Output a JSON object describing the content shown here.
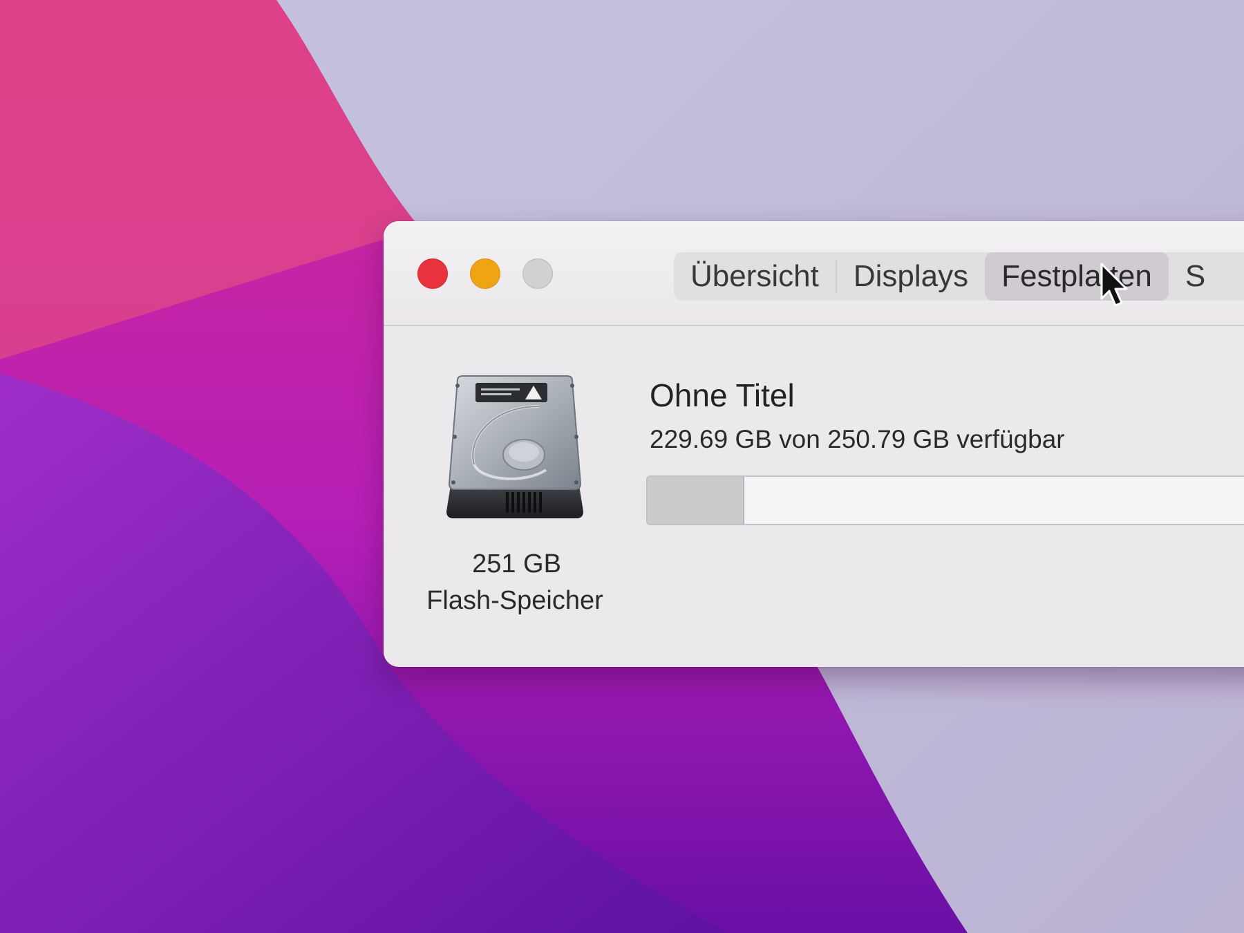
{
  "window": {
    "tabs": [
      {
        "label": "Übersicht",
        "selected": false
      },
      {
        "label": "Displays",
        "selected": false
      },
      {
        "label": "Festplatten",
        "selected": true
      },
      {
        "label": "S",
        "selected": false
      }
    ]
  },
  "disk": {
    "size": "251 GB",
    "type": "Flash-Speicher",
    "icon": "hard-drive-icon"
  },
  "volume": {
    "name": "Ohne Titel",
    "available_text": "229.69 GB von 250.79 GB verfügbar",
    "used_fraction": 0.084
  },
  "colors": {
    "close": "#e8333f",
    "minimize": "#efa414",
    "zoom": "#d3d0d3"
  }
}
